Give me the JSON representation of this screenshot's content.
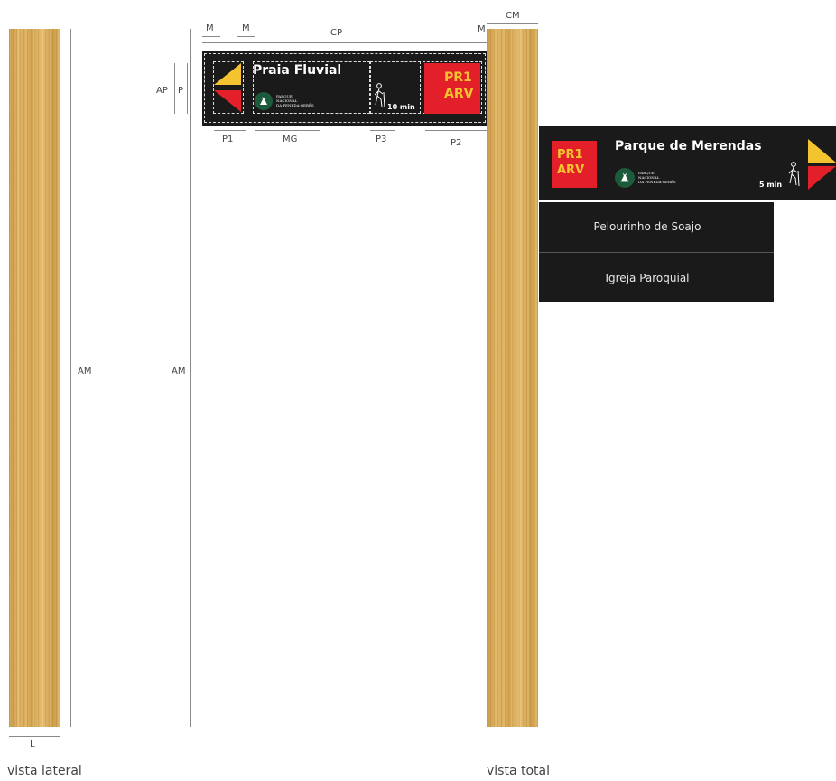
{
  "labels": {
    "am_left": "AM",
    "am_mid": "AM",
    "l": "L",
    "m1": "M",
    "m2": "M",
    "m3": "M",
    "cp": "CP",
    "cm": "CM",
    "ap": "AP",
    "p": "P",
    "p1": "P1",
    "mg": "MG",
    "p3": "P3",
    "p2": "P2"
  },
  "captions": {
    "side": "vista lateral",
    "total": "vista total"
  },
  "small_sign": {
    "title": "Praia Fluvial",
    "park_logo": [
      "PARQUE",
      "NACIONAL",
      "DA PENEDA-GERÊS"
    ],
    "time": "10 min",
    "route_code": [
      "PR1",
      "ARV"
    ]
  },
  "big_sign": {
    "route_code": [
      "PR1",
      "ARV"
    ],
    "title": "Parque de Merendas",
    "park_logo": [
      "PARQUE",
      "NACIONAL",
      "DA PENEDA-GERÊS"
    ],
    "time": "5 min",
    "rows": [
      "Pelourinho de Soajo",
      "Igreja Paroquial"
    ]
  },
  "colors": {
    "sign_black": "#1a1a1a",
    "route_red": "#e3202a",
    "route_yellow": "#f4c430",
    "park_green": "#1d5a3c"
  }
}
